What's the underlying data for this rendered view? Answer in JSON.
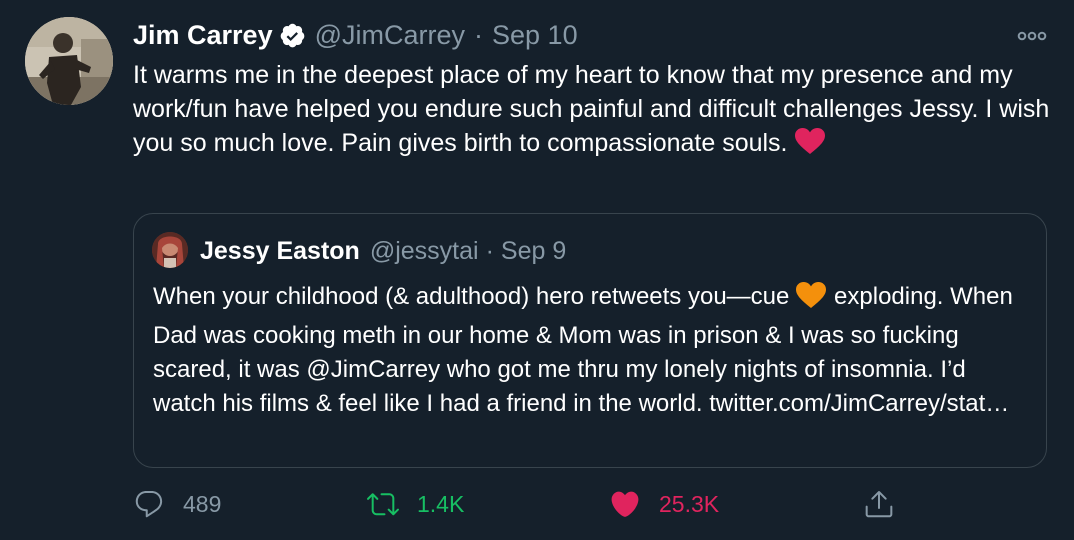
{
  "author": {
    "name": "Jim Carrey",
    "handle": "@JimCarrey",
    "separator": "·",
    "date": "Sep 10",
    "verified": true
  },
  "tweet": {
    "text": "It warms me in the deepest place of my heart to know that my presence and my work/fun have helped you endure such painful and difficult challenges Jessy. I wish you so much love. Pain gives birth to compassionate souls."
  },
  "quoted": {
    "name": "Jessy Easton",
    "handle": "@jessytai",
    "separator": "·",
    "date": "Sep 9",
    "text_before": "When your childhood (& adulthood) hero retweets you—cue",
    "text_after": "exploding. When Dad was cooking meth in our home & Mom was in prison & I was so fucking scared, it was @JimCarrey who got me thru my lonely nights of insomnia. I’d watch his films & feel like I had a friend in the world. twitter.com/JimCarrey/stat…"
  },
  "actions": {
    "replies": "489",
    "retweets": "1.4K",
    "likes": "25.3K",
    "liked": true,
    "retweeted": true
  },
  "colors": {
    "background": "#15202b",
    "secondary_text": "#8899a6",
    "border": "#38444d",
    "retweet_green": "#17bf63",
    "like_pink": "#e0245e",
    "verified_badge": "#ffffff",
    "red_heart_emoji": "#e0245e",
    "orange_heart_emoji": "#f4900c"
  },
  "icons": {
    "more": "more-horizontal-icon",
    "reply": "reply-icon",
    "retweet": "retweet-icon",
    "like": "heart-filled-icon",
    "share": "share-icon",
    "verified": "verified-badge-icon"
  }
}
